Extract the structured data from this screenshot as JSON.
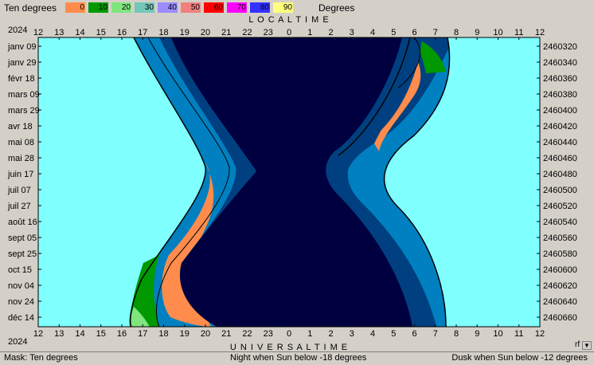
{
  "legend": {
    "title": "Ten degrees",
    "unit": "Degrees",
    "steps": [
      {
        "label": "0",
        "color": "#ff8c4c"
      },
      {
        "label": "10",
        "color": "#009900"
      },
      {
        "label": "20",
        "color": "#7fe57f"
      },
      {
        "label": "30",
        "color": "#72c7b8"
      },
      {
        "label": "40",
        "color": "#9c8cff"
      },
      {
        "label": "50",
        "color": "#f08080"
      },
      {
        "label": "60",
        "color": "#ff0000"
      },
      {
        "label": "70",
        "color": "#ff00ff"
      },
      {
        "label": "80",
        "color": "#3333ff"
      },
      {
        "label": "90",
        "color": "#ffff80"
      }
    ]
  },
  "chart_data": {
    "type": "area",
    "year": "2024",
    "top_axis_title": "L O C A L     T I M E",
    "bottom_axis_title": "U N I V E R S A L     T I M E",
    "hour_ticks": [
      "12",
      "13",
      "14",
      "15",
      "16",
      "17",
      "18",
      "19",
      "20",
      "21",
      "22",
      "23",
      "0",
      "1",
      "2",
      "3",
      "4",
      "5",
      "6",
      "7",
      "8",
      "9",
      "10",
      "11",
      "12"
    ],
    "date_labels": [
      "janv 09",
      "janv 29",
      "févr 18",
      "mars 09",
      "mars 29",
      "avr 18",
      "mai 08",
      "mai 28",
      "juin 17",
      "juil 07",
      "juil 27",
      "août 16",
      "sept 05",
      "sept 25",
      "oct 15",
      "nov 04",
      "nov 24",
      "déc 14"
    ],
    "julian_labels": [
      "2460320",
      "2460340",
      "2460360",
      "2460380",
      "2460400",
      "2460420",
      "2460440",
      "2460460",
      "2460480",
      "2460500",
      "2460520",
      "2460540",
      "2460560",
      "2460580",
      "2460600",
      "2460620",
      "2460640",
      "2460660"
    ],
    "colors": {
      "day": "#80ffff",
      "twilight_light": "#0080c0",
      "twilight_dark": "#004080",
      "night": "#000040",
      "moon_0": "#ff8c4c",
      "moon_10": "#009900",
      "moon_20": "#7fe57f"
    },
    "series": [
      {
        "name": "night",
        "threshold": "Sun below -18 degrees"
      },
      {
        "name": "dusk",
        "threshold": "Sun below -12 degrees"
      }
    ]
  },
  "status": {
    "mask": "Mask:  Ten degrees",
    "night": "Night when Sun below -18 degrees",
    "dusk": "Dusk when Sun below -12 degrees"
  },
  "scroll_hint": "rf"
}
